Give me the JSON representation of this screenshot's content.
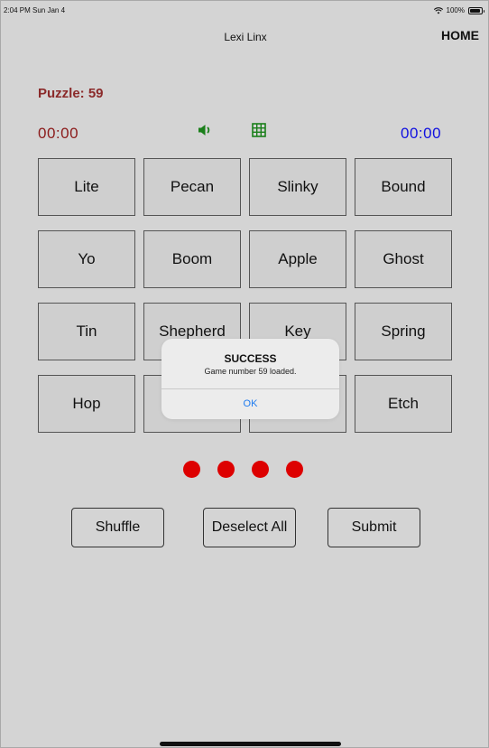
{
  "status_bar": {
    "time": "2:04 PM  Sun Jan 4",
    "battery": "100%"
  },
  "nav": {
    "title": "Lexi Linx",
    "home": "HOME"
  },
  "puzzle": {
    "label": "Puzzle: 59"
  },
  "timers": {
    "left": "00:00",
    "right": "00:00"
  },
  "colors": {
    "puzzle_label": "#8b2a2a",
    "timer_left": "#8b1a1a",
    "timer_right": "#1010e0",
    "icons": "#1a7f1a",
    "dots": "#dd0000",
    "ok": "#1e7bf0"
  },
  "icons": {
    "sound": "speaker-icon",
    "grid": "grid-icon"
  },
  "tiles": [
    "Lite",
    "Pecan",
    "Slinky",
    "Bound",
    "Yo",
    "Boom",
    "Apple",
    "Ghost",
    "Tin",
    "Shepherd",
    "Key",
    "Spring",
    "Hop",
    "",
    "",
    "Etch"
  ],
  "mistakes_remaining": 4,
  "buttons": {
    "shuffle": "Shuffle",
    "deselect": "Deselect All",
    "submit": "Submit"
  },
  "alert": {
    "title": "SUCCESS",
    "message": "Game number 59 loaded.",
    "ok": "OK"
  }
}
